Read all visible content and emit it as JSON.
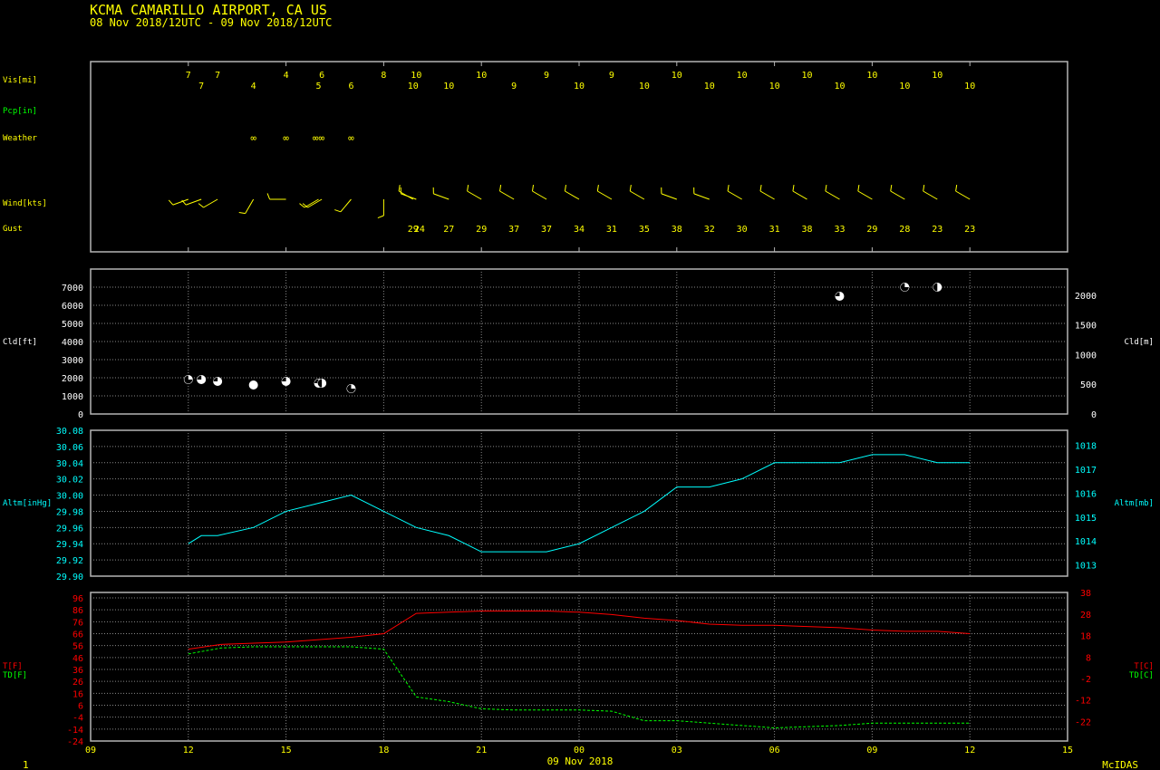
{
  "header": {
    "title": "KCMA  CAMARILLO AIRPORT, CA US",
    "subtitle": "08 Nov 2018/12UTC - 09 Nov 2018/12UTC"
  },
  "footer": {
    "left": "1",
    "date": "09 Nov 2018",
    "right": "McIDAS"
  },
  "colors": {
    "background": "#000000",
    "frame": "#b4b4b4",
    "text_yellow": "#ffff00",
    "cyan": "#00ffff",
    "red": "#ff0000",
    "green": "#00ff00",
    "grid": "#888888",
    "white": "#ffffff"
  },
  "chart_data": {
    "type": "line",
    "time_axis": {
      "units": "hours since 08 Nov 2018 09UTC",
      "range": [
        0,
        30
      ],
      "tick_hours": [
        0,
        3,
        6,
        9,
        12,
        15,
        18,
        21,
        24,
        27,
        30
      ],
      "tick_labels": [
        "09",
        "12",
        "15",
        "18",
        "21",
        "00",
        "03",
        "06",
        "09",
        "12",
        "15"
      ]
    },
    "obs_panel": {
      "row_labels": [
        "Vis[mi]",
        "Pcp[in]",
        "Weather",
        "Wind[kts]",
        "Gust"
      ],
      "visibility": [
        {
          "t": 3.0,
          "v": "7"
        },
        {
          "t": 3.4,
          "v": "7"
        },
        {
          "t": 3.9,
          "v": "7"
        },
        {
          "t": 5.0,
          "v": "4"
        },
        {
          "t": 6.0,
          "v": "4"
        },
        {
          "t": 7.0,
          "v": "5"
        },
        {
          "t": 7.1,
          "v": "6"
        },
        {
          "t": 8.0,
          "v": "6"
        },
        {
          "t": 9.0,
          "v": "8"
        },
        {
          "t": 9.9,
          "v": "10"
        },
        {
          "t": 10.0,
          "v": "10"
        },
        {
          "t": 11.0,
          "v": "10"
        },
        {
          "t": 12.0,
          "v": "10"
        },
        {
          "t": 13.0,
          "v": "9"
        },
        {
          "t": 14.0,
          "v": "9"
        },
        {
          "t": 15.0,
          "v": "10"
        },
        {
          "t": 16.0,
          "v": "9"
        },
        {
          "t": 17.0,
          "v": "10"
        },
        {
          "t": 18.0,
          "v": "10"
        },
        {
          "t": 19.0,
          "v": "10"
        },
        {
          "t": 20.0,
          "v": "10"
        },
        {
          "t": 21.0,
          "v": "10"
        },
        {
          "t": 22.0,
          "v": "10"
        },
        {
          "t": 23.0,
          "v": "10"
        },
        {
          "t": 24.0,
          "v": "10"
        },
        {
          "t": 25.0,
          "v": "10"
        },
        {
          "t": 26.0,
          "v": "10"
        },
        {
          "t": 27.0,
          "v": "10"
        }
      ],
      "weather": [
        {
          "t": 5.0,
          "v": "∞"
        },
        {
          "t": 6.0,
          "v": "∞"
        },
        {
          "t": 7.0,
          "v": "∞∞"
        },
        {
          "t": 8.0,
          "v": "∞"
        }
      ],
      "wind_barbs_deg": [
        {
          "t": 3.0,
          "dir": 250
        },
        {
          "t": 3.4,
          "dir": 250
        },
        {
          "t": 3.9,
          "dir": 240
        },
        {
          "t": 5.0,
          "dir": 210
        },
        {
          "t": 6.0,
          "dir": 270
        },
        {
          "t": 7.0,
          "dir": 240
        },
        {
          "t": 7.1,
          "dir": 240
        },
        {
          "t": 8.0,
          "dir": 220
        },
        {
          "t": 9.0,
          "dir": 180
        },
        {
          "t": 9.9,
          "dir": 300
        },
        {
          "t": 10.0,
          "dir": 290
        },
        {
          "t": 11.0,
          "dir": 290
        },
        {
          "t": 12.0,
          "dir": 300
        },
        {
          "t": 13.0,
          "dir": 300
        },
        {
          "t": 14.0,
          "dir": 300
        },
        {
          "t": 15.0,
          "dir": 300
        },
        {
          "t": 16.0,
          "dir": 300
        },
        {
          "t": 17.0,
          "dir": 300
        },
        {
          "t": 18.0,
          "dir": 290
        },
        {
          "t": 19.0,
          "dir": 290
        },
        {
          "t": 20.0,
          "dir": 300
        },
        {
          "t": 21.0,
          "dir": 300
        },
        {
          "t": 22.0,
          "dir": 300
        },
        {
          "t": 23.0,
          "dir": 300
        },
        {
          "t": 24.0,
          "dir": 300
        },
        {
          "t": 25.0,
          "dir": 300
        },
        {
          "t": 26.0,
          "dir": 300
        },
        {
          "t": 27.0,
          "dir": 300
        }
      ],
      "gust": [
        {
          "t": 9.9,
          "v": "29"
        },
        {
          "t": 10.1,
          "v": "24"
        },
        {
          "t": 11.0,
          "v": "27"
        },
        {
          "t": 12.0,
          "v": "29"
        },
        {
          "t": 13.0,
          "v": "37"
        },
        {
          "t": 14.0,
          "v": "37"
        },
        {
          "t": 15.0,
          "v": "34"
        },
        {
          "t": 16.0,
          "v": "31"
        },
        {
          "t": 17.0,
          "v": "35"
        },
        {
          "t": 18.0,
          "v": "38"
        },
        {
          "t": 19.0,
          "v": "32"
        },
        {
          "t": 20.0,
          "v": "30"
        },
        {
          "t": 21.0,
          "v": "31"
        },
        {
          "t": 22.0,
          "v": "38"
        },
        {
          "t": 23.0,
          "v": "33"
        },
        {
          "t": 24.0,
          "v": "29"
        },
        {
          "t": 25.0,
          "v": "28"
        },
        {
          "t": 26.0,
          "v": "23"
        },
        {
          "t": 27.0,
          "v": "23"
        }
      ]
    },
    "cloud_panel": {
      "ylabel_left": "Cld[ft]",
      "ylabel_right": "Cld[m]",
      "yticks_ft": [
        0,
        1000,
        2000,
        3000,
        4000,
        5000,
        6000,
        7000
      ],
      "yticks_m": [
        0,
        500,
        1000,
        1500,
        2000
      ],
      "ylim_ft": [
        0,
        7000
      ],
      "points": [
        {
          "t": 3.0,
          "ft": 1900,
          "cover": 0.25
        },
        {
          "t": 3.4,
          "ft": 1900,
          "cover": 0.75
        },
        {
          "t": 3.9,
          "ft": 1800,
          "cover": 0.75
        },
        {
          "t": 5.0,
          "ft": 1600,
          "cover": 1.0
        },
        {
          "t": 6.0,
          "ft": 1800,
          "cover": 0.75
        },
        {
          "t": 7.0,
          "ft": 1700,
          "cover": 0.75
        },
        {
          "t": 7.1,
          "ft": 1700,
          "cover": 0.5
        },
        {
          "t": 8.0,
          "ft": 1400,
          "cover": 0.25
        },
        {
          "t": 23.0,
          "ft": 6500,
          "cover": 0.75
        },
        {
          "t": 25.0,
          "ft": 7000,
          "cover": 0.25
        },
        {
          "t": 26.0,
          "ft": 7000,
          "cover": 0.5
        }
      ]
    },
    "altimeter_panel": {
      "ylabel_left": "Altm[inHg]",
      "ylabel_right": "Altm[mb]",
      "yticks_inhg": [
        "30.08",
        "30.06",
        "30.04",
        "30.02",
        "30.00",
        "29.98",
        "29.96",
        "29.94",
        "29.92",
        "29.90"
      ],
      "yticks_mb": [
        "1013",
        "1014",
        "1015",
        "1016",
        "1017",
        "1018"
      ],
      "ylim_inhg": [
        29.9,
        30.08
      ],
      "x": [
        3,
        3.4,
        3.9,
        5,
        6,
        7,
        8,
        9,
        10,
        11,
        12,
        13,
        14,
        15,
        16,
        17,
        18,
        19,
        20,
        21,
        22,
        23,
        24,
        25,
        26,
        27
      ],
      "y": [
        29.94,
        29.95,
        29.95,
        29.96,
        29.98,
        29.99,
        30.0,
        29.98,
        29.96,
        29.95,
        29.93,
        29.93,
        29.93,
        29.94,
        29.96,
        29.98,
        30.01,
        30.01,
        30.02,
        30.04,
        30.04,
        30.04,
        30.05,
        30.05,
        30.04,
        30.04
      ]
    },
    "temp_panel": {
      "ylabel_left_t": "T[F]",
      "ylabel_left_td": "TD[F]",
      "ylabel_right_t": "T[C]",
      "ylabel_right_td": "TD[C]",
      "yticks_f": [
        "96",
        "86",
        "76",
        "66",
        "56",
        "46",
        "36",
        "26",
        "16",
        "6",
        "-4",
        "-14",
        "-24"
      ],
      "yticks_c": [
        "38",
        "28",
        "18",
        "8",
        "-2",
        "-12",
        "-22"
      ],
      "ylim_f": [
        -24,
        96
      ],
      "series": [
        {
          "name": "T[F]",
          "color": "red",
          "x": [
            3,
            4,
            5,
            6,
            7,
            8,
            9,
            10,
            11,
            12,
            13,
            14,
            15,
            16,
            17,
            18,
            19,
            20,
            21,
            22,
            23,
            24,
            25,
            26,
            27
          ],
          "y": [
            53,
            57,
            58,
            59,
            61,
            63,
            66,
            83,
            84,
            85,
            85,
            85,
            84,
            82,
            79,
            77,
            74,
            73,
            73,
            72,
            71,
            69,
            68,
            68,
            66
          ]
        },
        {
          "name": "TD[F]",
          "color": "green",
          "x": [
            3,
            3.4,
            4,
            5,
            6,
            7,
            8,
            9,
            10,
            11,
            12,
            13,
            14,
            15,
            16,
            17,
            18,
            19,
            20,
            21,
            22,
            23,
            24,
            25,
            26,
            27
          ],
          "y": [
            49,
            51,
            54,
            55,
            55,
            55,
            55,
            53,
            13,
            9,
            3,
            2,
            2,
            2,
            1,
            -7,
            -7,
            -9,
            -11,
            -13,
            -12,
            -11,
            -9,
            -9,
            -9,
            -9
          ]
        }
      ]
    }
  }
}
